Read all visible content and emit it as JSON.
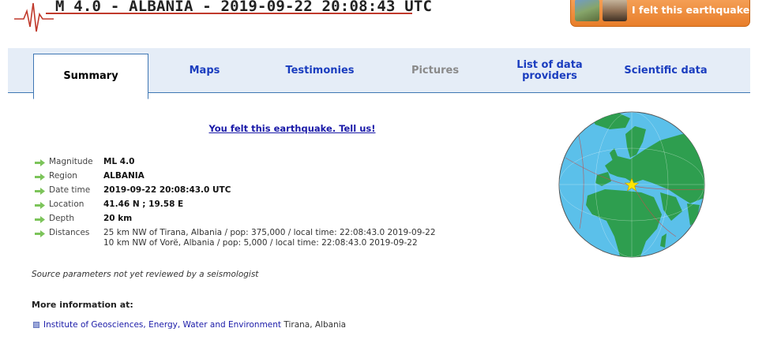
{
  "header": {
    "title": "M 4.0 - ALBANIA - 2019-09-22 20:08:43 UTC",
    "felt_button": "I felt this earthquake"
  },
  "tabs": [
    {
      "label": "Summary",
      "state": "active"
    },
    {
      "label": "Maps",
      "state": "normal"
    },
    {
      "label": "Testimonies",
      "state": "normal"
    },
    {
      "label": "Pictures",
      "state": "disabled"
    },
    {
      "label": "List of data providers",
      "state": "normal"
    },
    {
      "label": "Scientific data",
      "state": "normal"
    }
  ],
  "summary": {
    "tell_us_link": "You felt this earthquake. Tell us!",
    "params": [
      {
        "label": "Magnitude",
        "value": "ML 4.0"
      },
      {
        "label": "Region",
        "value": "ALBANIA"
      },
      {
        "label": "Date time",
        "value": "2019-09-22 20:08:43.0 UTC"
      },
      {
        "label": "Location",
        "value": "41.46 N ; 19.58 E"
      },
      {
        "label": "Depth",
        "value": "20 km"
      },
      {
        "label": "Distances",
        "value": "25 km NW of Tirana, Albania / pop: 375,000 / local time: 22:08:43.0 2019-09-22",
        "value2": "10 km NW of Vorë, Albania / pop: 5,000 / local time: 22:08:43.0 2019-09-22"
      }
    ],
    "review_note": "Source parameters not yet reviewed by a seismologist",
    "more_info_heading": "More information at:",
    "institute": {
      "name": "Institute of Geosciences, Energy, Water and Environment",
      "place": "Tirana, Albania"
    }
  },
  "colors": {
    "accent": "#e87e2a",
    "link": "#1a1aa8",
    "tab_bg": "#e5edf7",
    "ocean": "#5bc0ea",
    "land": "#2e9e4f"
  },
  "icons": {
    "arrow": "green-arrow-icon",
    "globe": "globe-map-icon",
    "epicenter": "star-icon"
  }
}
